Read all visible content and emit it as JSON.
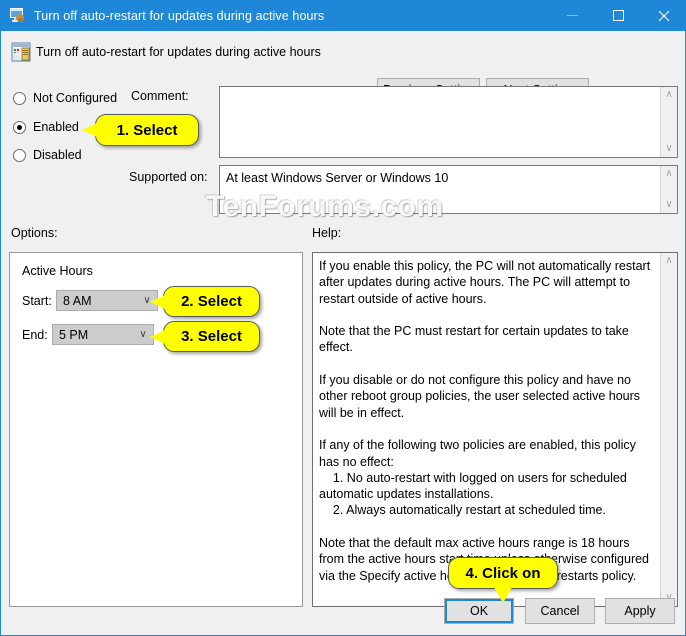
{
  "window": {
    "title": "Turn off auto-restart for updates during active hours",
    "icon": "computer-policy-icon",
    "accent_color": "#1f87d8",
    "minimize_label": "—",
    "maximize_label": "☐",
    "close_label": "✕"
  },
  "header": {
    "title": "Turn off auto-restart for updates during active hours",
    "icon": "group-policy-setting-icon",
    "previous_setting_label": "Previous Setting",
    "next_setting_label": "Next Setting"
  },
  "state": {
    "options": [
      {
        "label": "Not Configured",
        "checked": false
      },
      {
        "label": "Enabled",
        "checked": true
      },
      {
        "label": "Disabled",
        "checked": false
      }
    ]
  },
  "comment": {
    "label": "Comment:",
    "value": ""
  },
  "supported": {
    "label": "Supported on:",
    "value": "At least Windows Server or Windows 10"
  },
  "options_pane": {
    "label": "Options:",
    "group_title": "Active Hours",
    "start_label": "Start:",
    "start_value": "8 AM",
    "end_label": "End:",
    "end_value": "5 PM",
    "chevron": "∨"
  },
  "help_pane": {
    "label": "Help:",
    "text": "If you enable this policy, the PC will not automatically restart after updates during active hours. The PC will attempt to restart outside of active hours.\n\nNote that the PC must restart for certain updates to take effect.\n\nIf you disable or do not configure this policy and have no other reboot group policies, the user selected active hours will be in effect.\n\nIf any of the following two policies are enabled, this policy has no effect:\n    1. No auto-restart with logged on users for scheduled automatic updates installations.\n    2. Always automatically restart at scheduled time.\n\nNote that the default max active hours range is 18 hours from the active hours start time unless otherwise configured via the Specify active hours range for auto-restarts policy."
  },
  "footer": {
    "ok_label": "OK",
    "cancel_label": "Cancel",
    "apply_label": "Apply"
  },
  "callouts": [
    {
      "text": "1. Select"
    },
    {
      "text": "2. Select"
    },
    {
      "text": "3. Select"
    },
    {
      "text": "4. Click on"
    }
  ],
  "watermark": "TenForums.com",
  "scroll_arrows": {
    "up": "∧",
    "down": "∨"
  }
}
